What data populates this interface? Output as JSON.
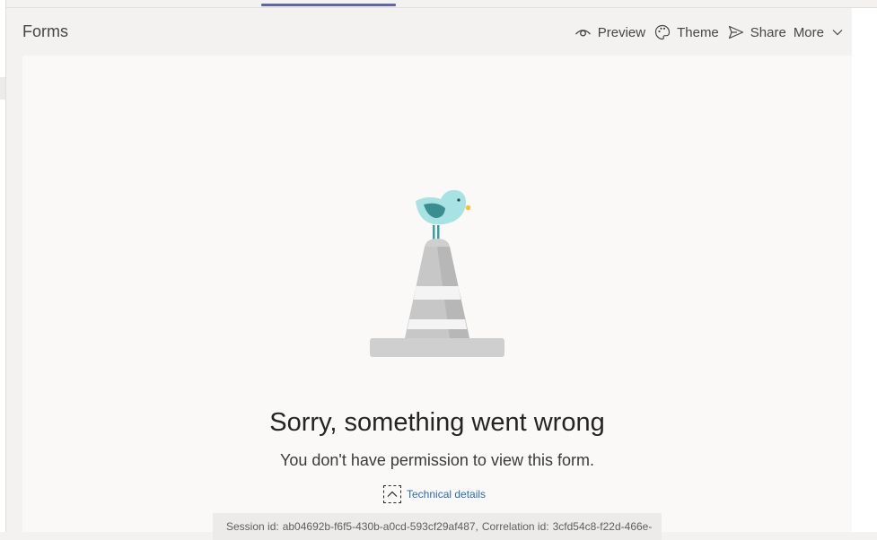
{
  "app": {
    "title": "Forms"
  },
  "toolbar": {
    "preview_label": "Preview",
    "theme_label": "Theme",
    "share_label": "Share",
    "more_label": "More"
  },
  "error": {
    "title": "Sorry, something went wrong",
    "message": "You don't have permission to view this form.",
    "details_label": "Technical details",
    "session_label": "Session id:",
    "session_id": "ab04692b-f6f5-430b-a0cd-593cf29af487,",
    "correlation_label": "Correlation id:",
    "correlation_id": "3cfd54c8-f22d-466e-"
  },
  "icons": {
    "preview": "eye-icon",
    "theme": "palette-icon",
    "share": "send-icon",
    "more": "chevron-down-icon",
    "details": "chevron-up-icon",
    "illustration": "bird-on-traffic-cone"
  },
  "colors": {
    "accent": "#6264a7",
    "link": "#2b6cb0",
    "content_bg": "#faf9f8",
    "header_bg": "#f3f2f1",
    "bird": "#a8e2e3",
    "cone": "#c8c8c8"
  }
}
